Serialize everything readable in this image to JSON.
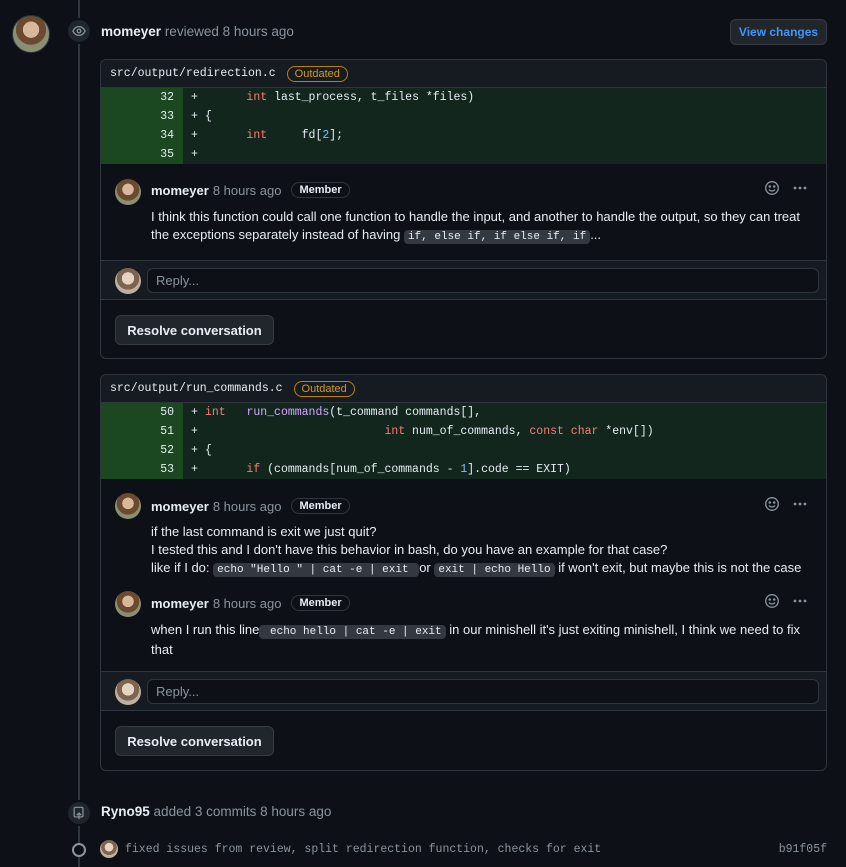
{
  "review": {
    "user": "momeyer",
    "action": "reviewed",
    "time": "8 hours ago",
    "view_changes_label": "View changes"
  },
  "threads": [
    {
      "path": "src/output/redirection.c",
      "badge": "Outdated",
      "lines": [
        {
          "num": "32",
          "sign": "+"
        },
        {
          "num": "33",
          "sign": "+"
        },
        {
          "num": "34",
          "sign": "+"
        },
        {
          "num": "35",
          "sign": "+"
        }
      ],
      "comments": [
        {
          "user": "momeyer",
          "time": "8 hours ago",
          "role": "Member",
          "text_1": "I think this function could call one function to handle the input, and another to handle the output, so they can treat the exceptions separately instead of having ",
          "code_1": "if, else if, if else if, if",
          "text_2": "..."
        }
      ],
      "reply_placeholder": "Reply...",
      "resolve_label": "Resolve conversation"
    },
    {
      "path": "src/output/run_commands.c",
      "badge": "Outdated",
      "lines": [
        {
          "num": "50",
          "sign": "+"
        },
        {
          "num": "51",
          "sign": "+"
        },
        {
          "num": "52",
          "sign": "+"
        },
        {
          "num": "53",
          "sign": "+"
        }
      ],
      "comments": [
        {
          "user": "momeyer",
          "time": "8 hours ago",
          "role": "Member",
          "line_1": "if the last command is exit we just quit?",
          "line_2": "I tested this and I don't have this behavior in bash, do you have an example for that case?",
          "line_3_a": "like if I do: ",
          "code_a": "echo \"Hello \" | cat -e | exit ",
          "line_3_b": " or ",
          "code_b": "exit | echo Hello",
          "line_3_c": " if won't exit, but maybe this is not the case"
        },
        {
          "user": "momeyer",
          "time": "8 hours ago",
          "role": "Member",
          "text_1": "when I run this line",
          "code_1": " echo hello | cat -e | exit",
          "text_2": " in our minishell it's just exiting minishell, I think we need to fix that"
        }
      ],
      "reply_placeholder": "Reply...",
      "resolve_label": "Resolve conversation"
    }
  ],
  "commits_event": {
    "user": "Ryno95",
    "action": "added 3 commits",
    "time": "8 hours ago",
    "commit_message": "fixed issues from review, split redirection function, checks for exit",
    "commit_sha": "b91f05f"
  },
  "colors": {
    "background": "#0d1117",
    "added_line": "#12261e",
    "added_gutter": "#1b4721",
    "link": "#4493f8",
    "outdated": "#d29922"
  }
}
